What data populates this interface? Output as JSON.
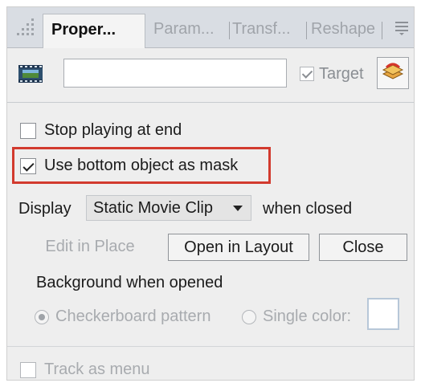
{
  "tabs": {
    "active": "Proper...",
    "items": [
      "Param...",
      "Transf...",
      "Reshape"
    ]
  },
  "instance": {
    "name_value": "",
    "target_label": "Target",
    "target_checked": true
  },
  "options": {
    "stop_playing_label": "Stop playing at end",
    "stop_playing_checked": false,
    "use_mask_label": "Use bottom object as mask",
    "use_mask_checked": true
  },
  "display": {
    "label": "Display",
    "selected": "Static Movie Clip",
    "suffix": "when closed"
  },
  "buttons": {
    "edit_in_place": "Edit in Place",
    "open_in_layout": "Open in Layout",
    "close": "Close"
  },
  "background": {
    "label": "Background when opened",
    "checkerboard_label": "Checkerboard pattern",
    "single_color_label": "Single color:",
    "selected": "checkerboard"
  },
  "track_as_menu": {
    "label": "Track as menu",
    "checked": false
  },
  "colors": {
    "highlight": "#d23a2e",
    "panel_bg": "#eeeeee",
    "tabbar_bg": "#d9dde3",
    "disabled_text": "#a8abaf"
  },
  "icons": {
    "grip": "panel-grip-icon",
    "movie": "movie-clip-icon",
    "target": "target-layers-icon",
    "menu": "panel-menu-icon"
  }
}
